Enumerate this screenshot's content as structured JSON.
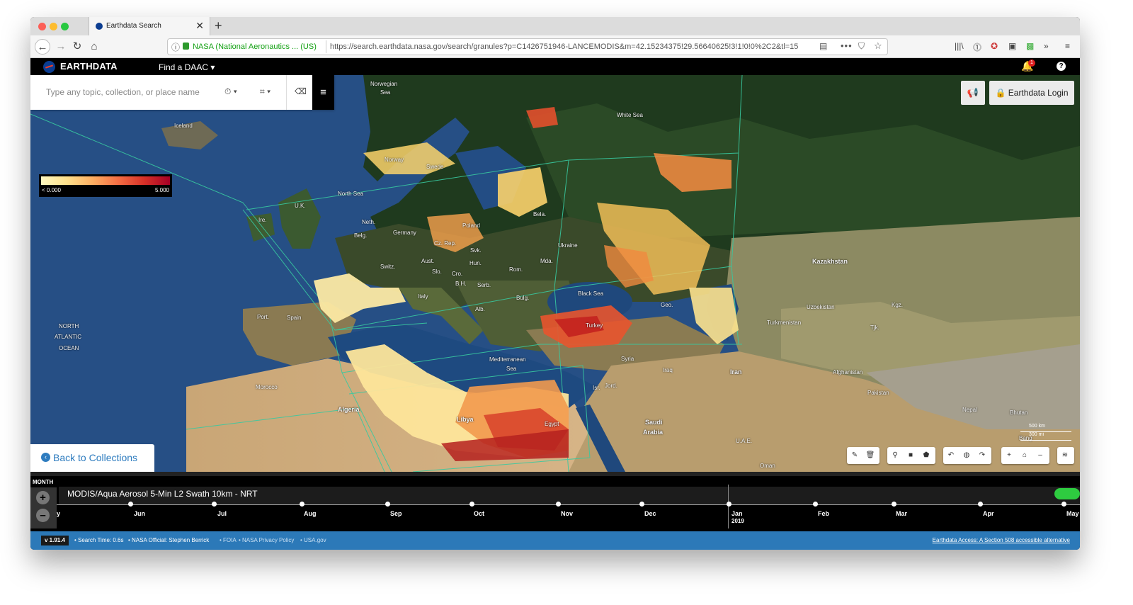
{
  "browser": {
    "tab_title": "Earthdata Search",
    "new_tab": "+",
    "tab_close": "✕",
    "url_org": "NASA (National Aeronautics ... (US)",
    "url": "https://search.earthdata.nasa.gov/search/granules?p=C1426751946-LANCEMODIS&m=42.15234375!29.56640625!3!1!0!0%2C2&tl=15",
    "nav_back": "←",
    "nav_forward": "→",
    "nav_reload": "↻",
    "nav_home": "⌂",
    "url_info": "ⓘ",
    "reader": "▤",
    "more": "•••",
    "pocket": "⛉",
    "star": "☆",
    "toolbar_icons": [
      "|||\\",
      "⓵",
      "✪",
      "▣",
      "▩",
      "»",
      "≡"
    ]
  },
  "site": {
    "brand": "EARTHDATA",
    "find_daac": "Find a DAAC ▾",
    "bell": "🔔",
    "notification_count": "1",
    "help": "?"
  },
  "search": {
    "placeholder": "Type any topic, collection, or place name",
    "temporal_icon": "⏱ ▾",
    "spatial_icon": "⌗ ▾",
    "clear_icon": "⌫",
    "menu_icon": "≡"
  },
  "legend": {
    "min": "< 0.000",
    "max": "5.000"
  },
  "header_buttons": {
    "announce": "📢",
    "login": "🔒 Earthdata Login"
  },
  "back": {
    "icon": "‹",
    "label": "Back to Collections"
  },
  "map_labels": {
    "norwegian_sea": "Norwegian",
    "norwegian_sea2": "Sea",
    "white_sea": "White Sea",
    "iceland": "Iceland",
    "norway": "Norway",
    "sweden": "Swede",
    "north_sea": "North Sea",
    "uk": "U.K.",
    "ire": "Ire.",
    "neth": "Neth.",
    "belg": "Belg.",
    "germany": "Germany",
    "poland": "Poland",
    "bela": "Bela.",
    "czrep": "Cz. Rep.",
    "svk": "Svk.",
    "ukraine": "Ukraine",
    "aust": "Aust.",
    "hun": "Hun.",
    "switz": "Switz.",
    "slo": "Slo.",
    "cro": "Cro.",
    "rom": "Rom.",
    "mda": "Mda.",
    "kazakhstan": "Kazakhstan",
    "bh": "B.H.",
    "serb": "Serb.",
    "italy": "Italy",
    "bulg": "Bulg.",
    "black_sea": "Black Sea",
    "alb": "Alb.",
    "port": "Port.",
    "spain": "Spain",
    "north_atlantic": "NORTH",
    "north_atlantic2": "ATLANTIC",
    "north_atlantic3": "OCEAN",
    "turkey": "Turkey",
    "geo": "Geo.",
    "uzbekistan": "Uzbekistan",
    "turkmenistan": "Turkmenistan",
    "kgz": "Kgz.",
    "tjk": "Tjk.",
    "med_sea": "Mediterranean",
    "med_sea2": "Sea",
    "syria": "Syria",
    "iraq": "Iraq",
    "iran": "Iran",
    "afghanistan": "Afghanistan",
    "pakistan": "Pakistan",
    "morocco": "Morocco",
    "algeria": "Algeria",
    "libya": "Libya",
    "egypt": "Egypt",
    "isr": "Isr.",
    "jord": "Jord.",
    "saudi": "Saudi",
    "saudi2": "Arabia",
    "uae": "U.A.E.",
    "oman": "Oman",
    "nepal": "Nepal",
    "bhutan": "Bhutan",
    "bang": "Bang"
  },
  "map_tools": {
    "edit": "✎",
    "delete": "🗑",
    "marker": "⚲",
    "rectangle": "■",
    "polygon": "⬟",
    "rotate_left": "↶",
    "globe": "◍",
    "rotate_right": "↷",
    "zoom_in": "+",
    "home": "⌂",
    "zoom_out": "–",
    "layers": "≋"
  },
  "scale": {
    "km": "500 km",
    "mi": "300 mi"
  },
  "timeline": {
    "zoom_level": "MONTH",
    "zoom_in": "+",
    "zoom_out": "–",
    "collection": "MODIS/Aqua Aerosol 5-Min L2 Swath 10km - NRT",
    "months": [
      "y",
      "Jun",
      "Jul",
      "Aug",
      "Sep",
      "Oct",
      "Nov",
      "Dec",
      "Jan",
      "Feb",
      "Mar",
      "Apr",
      "May"
    ],
    "year": "2019"
  },
  "footer": {
    "version": "v 1.91.4",
    "search_time": "• Search Time: 0.6s",
    "official": "• NASA Official: Stephen Berrick",
    "foia": "• FOIA",
    "privacy": "• NASA Privacy Policy",
    "usa": "• USA.gov",
    "section508": "Earthdata Access: A Section 508 accessible alternative"
  }
}
